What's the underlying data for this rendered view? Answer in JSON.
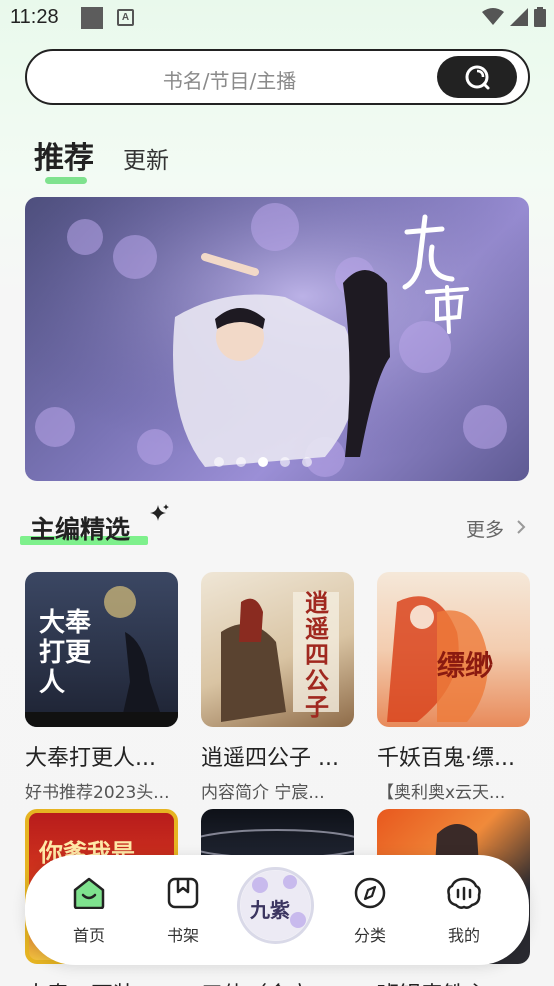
{
  "status_bar": {
    "time": "11:28",
    "notification_icon": "A"
  },
  "search": {
    "placeholder": "书名/节目/主播"
  },
  "tabs": {
    "recommend": "推荐",
    "update": "更新"
  },
  "banner": {
    "title_art": "九重紫",
    "dots_count": 5,
    "active_dot": 2
  },
  "section": {
    "title": "主编精选",
    "more": "更多"
  },
  "books": [
    {
      "title": "大奉打更人...",
      "desc": "好书推荐2023头...",
      "cover_text": "大奉打更人"
    },
    {
      "title": "逍遥四公子 ...",
      "desc": "内容简介 宁宸...",
      "cover_text": "逍遥四公子"
    },
    {
      "title": "千妖百鬼·缥...",
      "desc": "【奥利奥x云天...",
      "cover_text": "缥缈"
    },
    {
      "title": "大奉：不装...",
      "desc": "",
      "cover_text": "你爹我是"
    },
    {
      "title": "三体（会立...",
      "desc": "",
      "cover_text": ""
    },
    {
      "title": "班银表铁主...",
      "desc": "",
      "cover_text": ""
    }
  ],
  "nav": {
    "home": "首页",
    "shelf": "书架",
    "center_art": "九紫",
    "category": "分类",
    "mine": "我的"
  },
  "colors": {
    "accent": "#7fe28e",
    "dark": "#222222"
  }
}
